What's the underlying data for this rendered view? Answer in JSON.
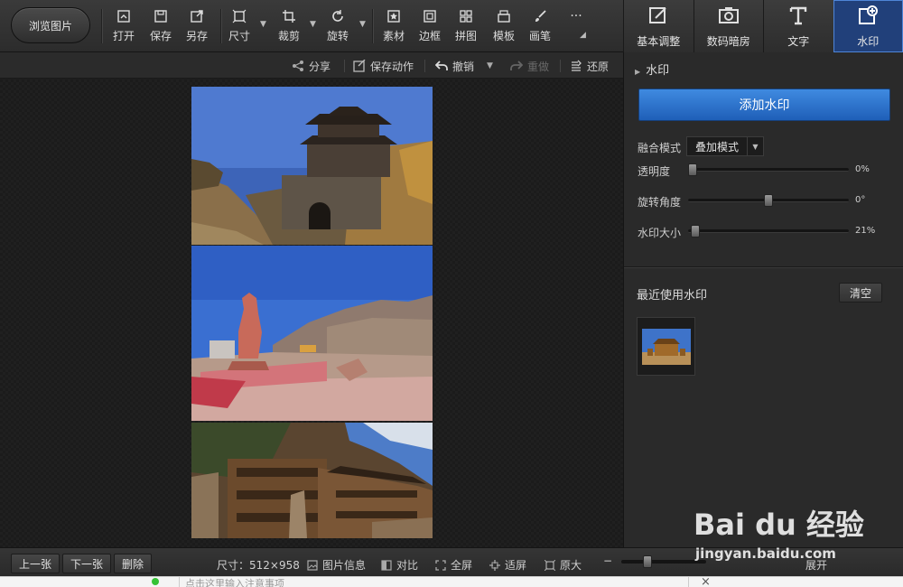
{
  "toolbar": {
    "browse_label": "浏览图片",
    "tools": [
      {
        "label": "打开",
        "icon": "open-icon"
      },
      {
        "label": "保存",
        "icon": "save-icon"
      },
      {
        "label": "另存",
        "icon": "save-as-icon"
      },
      {
        "label": "尺寸",
        "icon": "resize-icon"
      },
      {
        "label": "裁剪",
        "icon": "crop-icon"
      },
      {
        "label": "旋转",
        "icon": "rotate-icon"
      },
      {
        "label": "素材",
        "icon": "material-icon"
      },
      {
        "label": "边框",
        "icon": "border-icon"
      },
      {
        "label": "拼图",
        "icon": "collage-icon"
      },
      {
        "label": "模板",
        "icon": "template-icon"
      },
      {
        "label": "画笔",
        "icon": "brush-icon"
      }
    ],
    "more_icon": "more-icon"
  },
  "right_tabs": [
    {
      "label": "基本调整",
      "icon": "adjust-icon",
      "active": false
    },
    {
      "label": "数码暗房",
      "icon": "darkroom-icon",
      "active": false
    },
    {
      "label": "文字",
      "icon": "text-icon",
      "active": false
    },
    {
      "label": "水印",
      "icon": "watermark-icon",
      "active": true
    }
  ],
  "actions": {
    "share": "分享",
    "save_action": "保存动作",
    "undo": "撤销",
    "redo": "重做",
    "restore": "还原"
  },
  "panel": {
    "section_title": "水印",
    "add_button": "添加水印",
    "blend_label": "融合模式",
    "blend_value": "叠加模式",
    "opacity_label": "透明度",
    "opacity_value": "0%",
    "opacity_level": 0,
    "rotation_label": "旋转角度",
    "rotation_value": "0°",
    "rotation_level": 0.5,
    "size_label": "水印大小",
    "size_value": "21%",
    "size_level": 0.02,
    "recent_title": "最近使用水印",
    "clear_button": "清空"
  },
  "statusbar": {
    "prev": "上一张",
    "next": "下一张",
    "delete": "删除",
    "size_text": "尺寸：512×958",
    "info": "图片信息",
    "compare": "对比",
    "fullscreen": "全屏",
    "fit": "适屏",
    "original": "原大",
    "zoom_level": 0.28,
    "expand": "展开"
  },
  "bottom_strip": {
    "note_placeholder": "点击这里输入注意事项"
  },
  "watermark": {
    "brand": "Bai du 经验",
    "url": "jingyan.baidu.com"
  },
  "colors": {
    "accent": "#2f76d2",
    "active_tab": "#21407a",
    "background": "#1e1e1e"
  }
}
